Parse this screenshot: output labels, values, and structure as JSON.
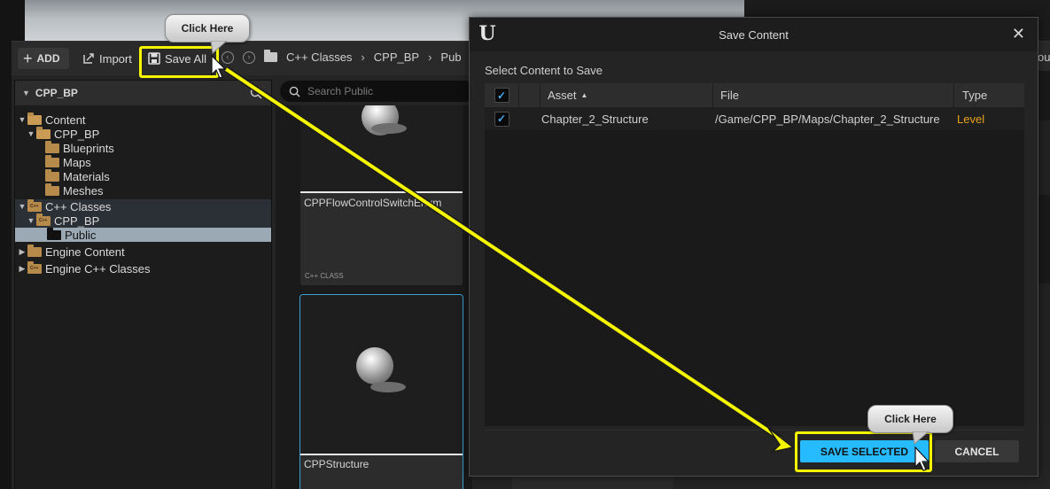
{
  "colors": {
    "accent": "#26bbff",
    "highlight": "#f5f500",
    "level_type": "#e8a21a",
    "folder": "#b68a4b",
    "selected_row": "#9aa9b4"
  },
  "toolbar": {
    "add_label": "ADD",
    "import_label": "Import",
    "save_all_label": "Save All",
    "breadcrumbs": [
      "C++ Classes",
      "CPP_BP",
      "Pub"
    ],
    "edge_text": "ou"
  },
  "tree": {
    "header": "CPP_BP",
    "items": [
      {
        "label": "Content",
        "icon": "folder-open-icon"
      },
      {
        "label": "CPP_BP",
        "icon": "folder-open-icon"
      },
      {
        "label": "Blueprints",
        "icon": "folder-icon"
      },
      {
        "label": "Maps",
        "icon": "folder-icon"
      },
      {
        "label": "Materials",
        "icon": "folder-icon"
      },
      {
        "label": "Meshes",
        "icon": "folder-icon"
      },
      {
        "label": "C++ Classes",
        "icon": "cpp-folder-icon"
      },
      {
        "label": "CPP_BP",
        "icon": "cpp-folder-icon"
      },
      {
        "label": "Public",
        "icon": "folder-icon"
      },
      {
        "label": "Engine Content",
        "icon": "folder-icon"
      },
      {
        "label": "Engine C++ Classes",
        "icon": "cpp-folder-icon"
      }
    ]
  },
  "search": {
    "placeholder": "Search Public"
  },
  "assets": [
    {
      "name": "CPPFlowControlSwitchEnum",
      "class": "C++ CLASS"
    },
    {
      "name": "CPPStructure",
      "class": ""
    }
  ],
  "dialog": {
    "title": "Save Content",
    "logo": "U",
    "close": "✕",
    "subtitle": "Select Content to Save",
    "columns": {
      "asset": "Asset",
      "file": "File",
      "type": "Type"
    },
    "rows": [
      {
        "checked": true,
        "asset": "Chapter_2_Structure",
        "file": "/Game/CPP_BP/Maps/Chapter_2_Structure",
        "type": "Level"
      }
    ],
    "save_selected_label": "SAVE SELECTED",
    "cancel_label": "CANCEL"
  },
  "callouts": {
    "top": "Click Here",
    "bottom": "Click Here"
  }
}
